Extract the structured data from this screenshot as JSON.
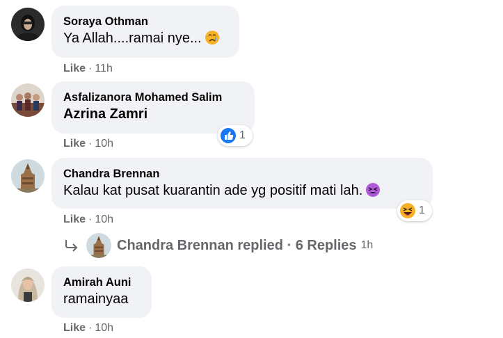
{
  "comments": [
    {
      "author": "Soraya Othman",
      "text": "Ya Allah....ramai nye...",
      "emoji": "crying-face-icon",
      "like_label": "Like",
      "dot": "·",
      "time": "11h"
    },
    {
      "author": "Asfalizanora Mohamed Salim",
      "text": "Azrina Zamri",
      "like_label": "Like",
      "dot": "·",
      "time": "10h",
      "reaction_icon": "like-reaction-icon",
      "reaction_count": "1"
    },
    {
      "author": "Chandra Brennan",
      "text": "Kalau kat pusat kuarantin ade yg positif mati lah.",
      "emoji": "tired-face-icon",
      "like_label": "Like",
      "dot": "·",
      "time": "10h",
      "reaction_icon": "haha-reaction-icon",
      "reaction_count": "1"
    },
    {
      "author": "Amirah Auni",
      "text": "ramainyaa",
      "like_label": "Like",
      "dot": "·",
      "time": "10h"
    }
  ],
  "replies_row": {
    "text": "Chandra Brennan replied · 6 Replies",
    "time": "1h"
  },
  "colors": {
    "bubble": "#f0f2f5",
    "meta": "#65676b",
    "like_blue": "#1877f2",
    "haha_yellow": "#f7b125"
  }
}
